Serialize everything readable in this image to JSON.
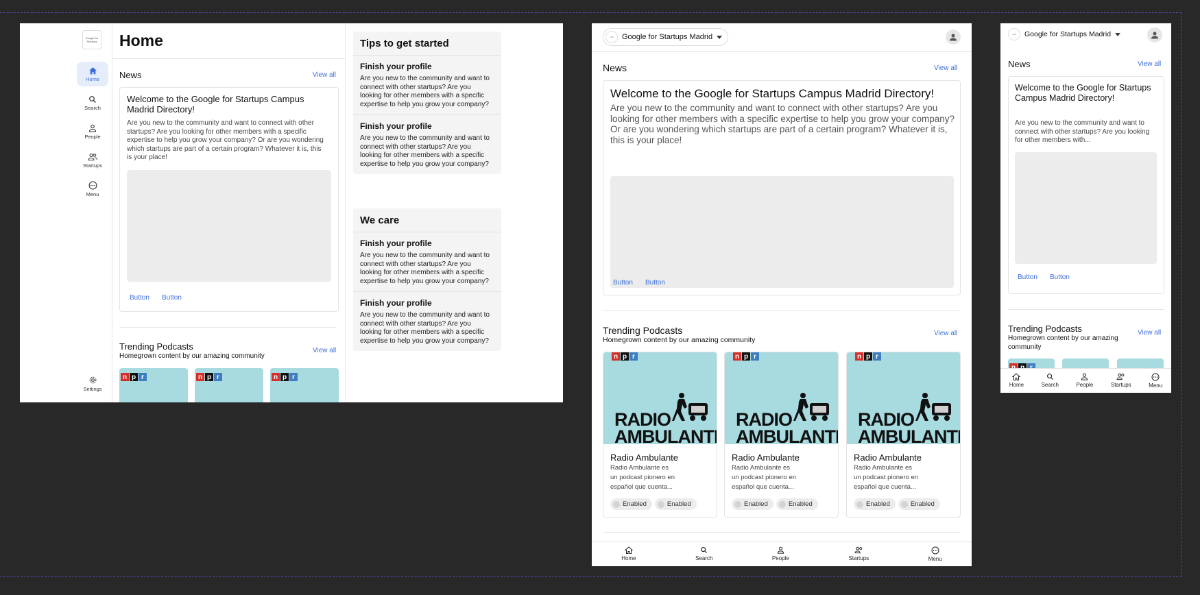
{
  "desktop": {
    "logo_text": "Google for Startups",
    "page_title": "Home",
    "rail": [
      {
        "label": "Home",
        "icon": "home-icon"
      },
      {
        "label": "Search",
        "icon": "search-icon"
      },
      {
        "label": "People",
        "icon": "person-icon"
      },
      {
        "label": "Startups",
        "icon": "group-icon"
      },
      {
        "label": "Menu",
        "icon": "more-icon"
      }
    ],
    "settings_label": "Settings",
    "news": {
      "title": "News",
      "view_all": "View all",
      "card_title": "Welcome to the Google for Startups Campus Madrid Directory!",
      "card_body": "Are you new to the community and want to connect with other startups? Are you looking for other members with a specific expertise to help you grow your company? Or are you wondering which startups are part of a certain program? Whatever it is, this is your place!",
      "button1": "Button",
      "button2": "Button"
    },
    "podcasts": {
      "title": "Trending Podcasts",
      "subtitle": "Homegrown content by our amazing community",
      "view_all": "View all"
    },
    "tips": {
      "title": "Tips to get started",
      "items": [
        {
          "title": "Finish your profile",
          "body": "Are you new to the community and want to connect with other startups? Are you looking for other members with a specific expertise to help you grow your company?"
        },
        {
          "title": "Finish your profile",
          "body": "Are you new to the community and want to connect with other startups? Are you looking for other members with a specific expertise to help you grow your company?"
        }
      ]
    },
    "care": {
      "title": "We care",
      "items": [
        {
          "title": "Finish your profile",
          "body": "Are you new to the community and want to connect with other startups? Are you looking for other members with a specific expertise to help you grow your company?"
        },
        {
          "title": "Finish your profile",
          "body": "Are you new to the community and want to connect with other startups? Are you looking for other members with a specific expertise to help you grow your company?"
        }
      ]
    }
  },
  "tablet": {
    "selector": "Google for Startups Madrid",
    "news_title": "News",
    "view_all": "View all",
    "card_title": "Welcome to the Google for Startups Campus Madrid Directory!",
    "card_body": "Are you new to the community and want to connect with other startups? Are you looking for other members with a specific expertise to help you grow your company? Or are you wondering which startups are part of a certain program? Whatever it is, this is your place!",
    "button1": "Button",
    "button2": "Button",
    "podcasts_title": "Trending Podcasts",
    "podcasts_subtitle": "Homegrown content by our amazing community",
    "podcasts_view_all": "View all",
    "podcast": {
      "npr": [
        "n",
        "p",
        "r"
      ],
      "art_line1": "RADIO",
      "art_line2": "AMBULANTE",
      "name": "Radio Ambulante",
      "desc1": "Radio Ambulante es",
      "desc2": "un podcast pionero en",
      "desc3": "español que cuenta...",
      "chip": "Enabled"
    },
    "nav": [
      {
        "label": "Home",
        "icon": "home-icon"
      },
      {
        "label": "Search",
        "icon": "search-icon"
      },
      {
        "label": "People",
        "icon": "person-icon"
      },
      {
        "label": "Startups",
        "icon": "group-icon"
      },
      {
        "label": "Menu",
        "icon": "more-icon"
      }
    ]
  },
  "mobile": {
    "selector": "Google for Startups Madrid",
    "news_title": "News",
    "view_all": "View all",
    "card_title": "Welcome to the Google for Startups Campus Madrid Directory!",
    "card_body": "Are you new to the community and want to connect with other startups? Are you looking for other members with...",
    "button1": "Button",
    "button2": "Button",
    "podcasts_title": "Trending Podcasts",
    "podcasts_subtitle": "Homegrown content by our amazing community",
    "podcasts_view_all": "View all",
    "nav": [
      {
        "label": "Home",
        "icon": "home-icon"
      },
      {
        "label": "Search",
        "icon": "search-icon"
      },
      {
        "label": "People",
        "icon": "person-icon"
      },
      {
        "label": "Startups",
        "icon": "group-icon"
      },
      {
        "label": "Menu",
        "icon": "more-icon"
      }
    ]
  },
  "colors": {
    "accent": "#3d6fd9",
    "background": "#282828",
    "podcast_art": "#a7dbe0",
    "guide": "#4d4fb3"
  }
}
